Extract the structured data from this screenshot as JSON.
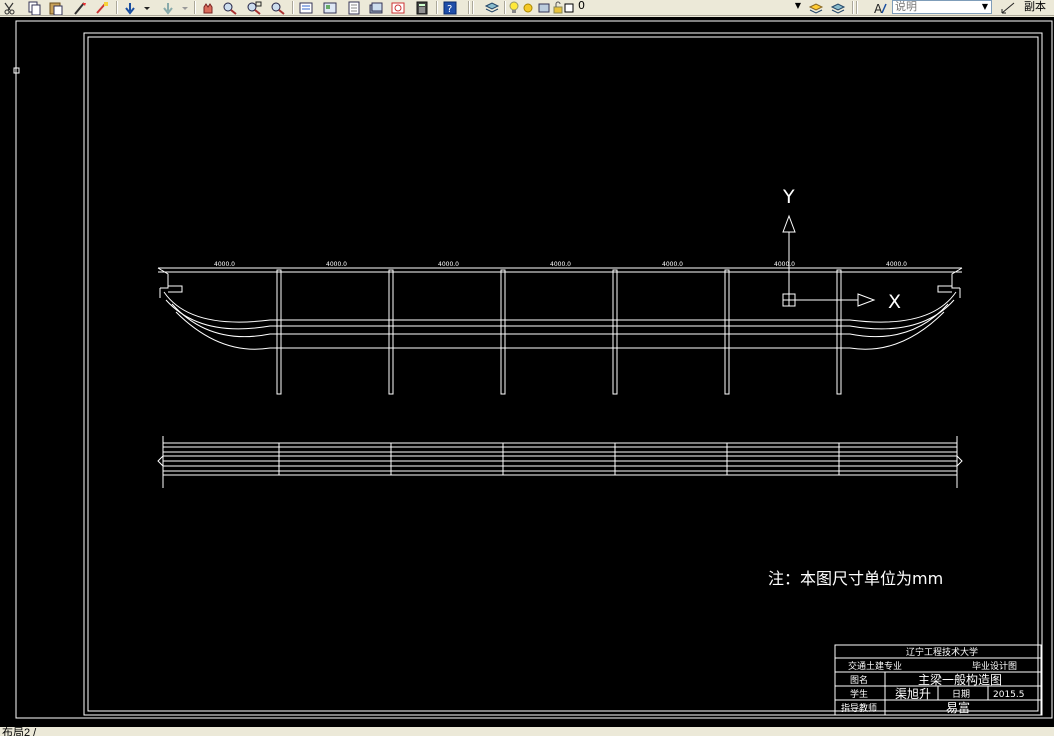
{
  "toolbar": {
    "layer_value": "0",
    "textstyle_value": "说明",
    "copy_label": "副本"
  },
  "drawing": {
    "dimension_labels": [
      "4000.0",
      "4000.0",
      "4000.0",
      "4000.0",
      "4000.0",
      "4000.0",
      "4000.0"
    ],
    "ucs_y_label": "Y",
    "ucs_x_label": "X",
    "note": "注：本图尺寸单位为mm"
  },
  "title_block": {
    "university": "辽宁工程技术大学",
    "major": "交通土建专业",
    "design_type": "毕业设计图",
    "name_label": "图名",
    "drawing_name": "主梁一般构造图",
    "student_label": "学生",
    "student_name": "渠旭升",
    "date_label": "日期",
    "date_value": "2015.5",
    "advisor_label": "指导教师",
    "advisor_name": "易富"
  },
  "status": {
    "layout_tab": "布局2 /"
  },
  "colors": {
    "canvas_bg": "#000000",
    "drawing_lines": "#ffffff",
    "chrome_bg": "#ece9d8"
  }
}
